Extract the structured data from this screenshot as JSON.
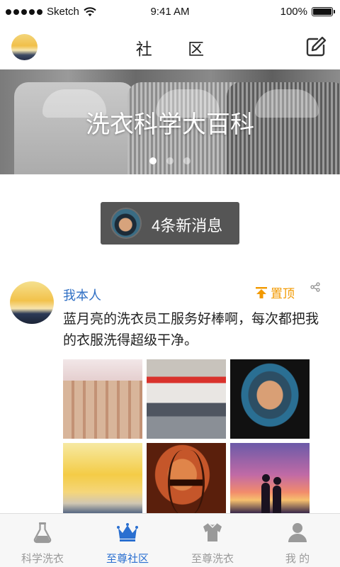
{
  "status_bar": {
    "carrier": "Sketch",
    "time": "9:41 AM",
    "battery": "100%"
  },
  "navbar": {
    "title": "社 区",
    "edit_icon": "edit-icon"
  },
  "banner": {
    "title": "洗衣科学大百科",
    "pages": 3,
    "active_page": 1
  },
  "new_messages": {
    "label": "4条新消息"
  },
  "post": {
    "author": "我本人",
    "pin_label": "置顶",
    "text": "蓝月亮的洗衣员工服务好棒啊，每次都把我的衣服洗得超级干净。",
    "image_count": 6
  },
  "tabbar": {
    "items": [
      {
        "label": "科学洗衣",
        "icon": "flask-icon",
        "active": false
      },
      {
        "label": "至尊社区",
        "icon": "crown-icon",
        "active": true
      },
      {
        "label": "至尊洗衣",
        "icon": "shirt-icon",
        "active": false
      },
      {
        "label": "我 的",
        "icon": "user-icon",
        "active": false
      }
    ]
  },
  "colors": {
    "accent_blue": "#2a6fd0",
    "pin_orange": "#f29900",
    "tab_inactive": "#9a9a9a"
  }
}
